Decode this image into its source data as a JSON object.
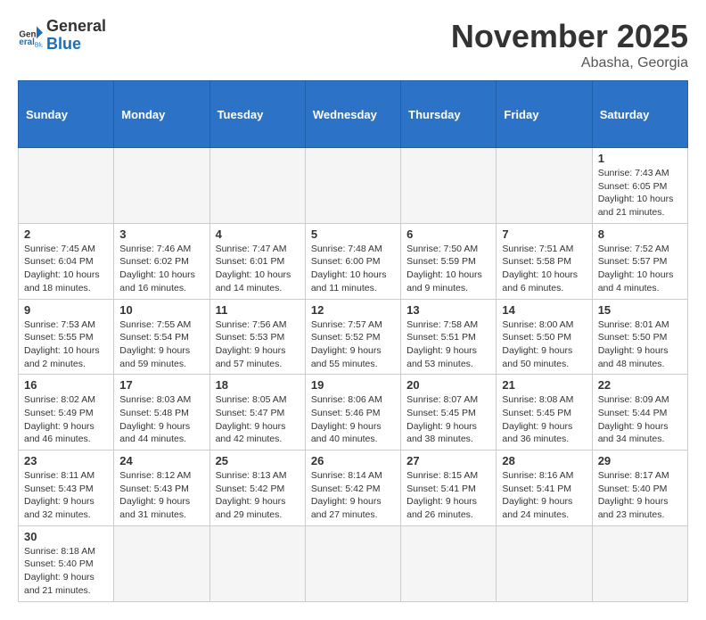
{
  "header": {
    "logo_general": "General",
    "logo_blue": "Blue",
    "month_title": "November 2025",
    "location": "Abasha, Georgia"
  },
  "weekdays": [
    "Sunday",
    "Monday",
    "Tuesday",
    "Wednesday",
    "Thursday",
    "Friday",
    "Saturday"
  ],
  "weeks": [
    [
      {
        "day": "",
        "info": ""
      },
      {
        "day": "",
        "info": ""
      },
      {
        "day": "",
        "info": ""
      },
      {
        "day": "",
        "info": ""
      },
      {
        "day": "",
        "info": ""
      },
      {
        "day": "",
        "info": ""
      },
      {
        "day": "1",
        "info": "Sunrise: 7:43 AM\nSunset: 6:05 PM\nDaylight: 10 hours and 21 minutes."
      }
    ],
    [
      {
        "day": "2",
        "info": "Sunrise: 7:45 AM\nSunset: 6:04 PM\nDaylight: 10 hours and 18 minutes."
      },
      {
        "day": "3",
        "info": "Sunrise: 7:46 AM\nSunset: 6:02 PM\nDaylight: 10 hours and 16 minutes."
      },
      {
        "day": "4",
        "info": "Sunrise: 7:47 AM\nSunset: 6:01 PM\nDaylight: 10 hours and 14 minutes."
      },
      {
        "day": "5",
        "info": "Sunrise: 7:48 AM\nSunset: 6:00 PM\nDaylight: 10 hours and 11 minutes."
      },
      {
        "day": "6",
        "info": "Sunrise: 7:50 AM\nSunset: 5:59 PM\nDaylight: 10 hours and 9 minutes."
      },
      {
        "day": "7",
        "info": "Sunrise: 7:51 AM\nSunset: 5:58 PM\nDaylight: 10 hours and 6 minutes."
      },
      {
        "day": "8",
        "info": "Sunrise: 7:52 AM\nSunset: 5:57 PM\nDaylight: 10 hours and 4 minutes."
      }
    ],
    [
      {
        "day": "9",
        "info": "Sunrise: 7:53 AM\nSunset: 5:55 PM\nDaylight: 10 hours and 2 minutes."
      },
      {
        "day": "10",
        "info": "Sunrise: 7:55 AM\nSunset: 5:54 PM\nDaylight: 9 hours and 59 minutes."
      },
      {
        "day": "11",
        "info": "Sunrise: 7:56 AM\nSunset: 5:53 PM\nDaylight: 9 hours and 57 minutes."
      },
      {
        "day": "12",
        "info": "Sunrise: 7:57 AM\nSunset: 5:52 PM\nDaylight: 9 hours and 55 minutes."
      },
      {
        "day": "13",
        "info": "Sunrise: 7:58 AM\nSunset: 5:51 PM\nDaylight: 9 hours and 53 minutes."
      },
      {
        "day": "14",
        "info": "Sunrise: 8:00 AM\nSunset: 5:50 PM\nDaylight: 9 hours and 50 minutes."
      },
      {
        "day": "15",
        "info": "Sunrise: 8:01 AM\nSunset: 5:50 PM\nDaylight: 9 hours and 48 minutes."
      }
    ],
    [
      {
        "day": "16",
        "info": "Sunrise: 8:02 AM\nSunset: 5:49 PM\nDaylight: 9 hours and 46 minutes."
      },
      {
        "day": "17",
        "info": "Sunrise: 8:03 AM\nSunset: 5:48 PM\nDaylight: 9 hours and 44 minutes."
      },
      {
        "day": "18",
        "info": "Sunrise: 8:05 AM\nSunset: 5:47 PM\nDaylight: 9 hours and 42 minutes."
      },
      {
        "day": "19",
        "info": "Sunrise: 8:06 AM\nSunset: 5:46 PM\nDaylight: 9 hours and 40 minutes."
      },
      {
        "day": "20",
        "info": "Sunrise: 8:07 AM\nSunset: 5:45 PM\nDaylight: 9 hours and 38 minutes."
      },
      {
        "day": "21",
        "info": "Sunrise: 8:08 AM\nSunset: 5:45 PM\nDaylight: 9 hours and 36 minutes."
      },
      {
        "day": "22",
        "info": "Sunrise: 8:09 AM\nSunset: 5:44 PM\nDaylight: 9 hours and 34 minutes."
      }
    ],
    [
      {
        "day": "23",
        "info": "Sunrise: 8:11 AM\nSunset: 5:43 PM\nDaylight: 9 hours and 32 minutes."
      },
      {
        "day": "24",
        "info": "Sunrise: 8:12 AM\nSunset: 5:43 PM\nDaylight: 9 hours and 31 minutes."
      },
      {
        "day": "25",
        "info": "Sunrise: 8:13 AM\nSunset: 5:42 PM\nDaylight: 9 hours and 29 minutes."
      },
      {
        "day": "26",
        "info": "Sunrise: 8:14 AM\nSunset: 5:42 PM\nDaylight: 9 hours and 27 minutes."
      },
      {
        "day": "27",
        "info": "Sunrise: 8:15 AM\nSunset: 5:41 PM\nDaylight: 9 hours and 26 minutes."
      },
      {
        "day": "28",
        "info": "Sunrise: 8:16 AM\nSunset: 5:41 PM\nDaylight: 9 hours and 24 minutes."
      },
      {
        "day": "29",
        "info": "Sunrise: 8:17 AM\nSunset: 5:40 PM\nDaylight: 9 hours and 23 minutes."
      }
    ],
    [
      {
        "day": "30",
        "info": "Sunrise: 8:18 AM\nSunset: 5:40 PM\nDaylight: 9 hours and 21 minutes."
      },
      {
        "day": "",
        "info": ""
      },
      {
        "day": "",
        "info": ""
      },
      {
        "day": "",
        "info": ""
      },
      {
        "day": "",
        "info": ""
      },
      {
        "day": "",
        "info": ""
      },
      {
        "day": "",
        "info": ""
      }
    ]
  ]
}
